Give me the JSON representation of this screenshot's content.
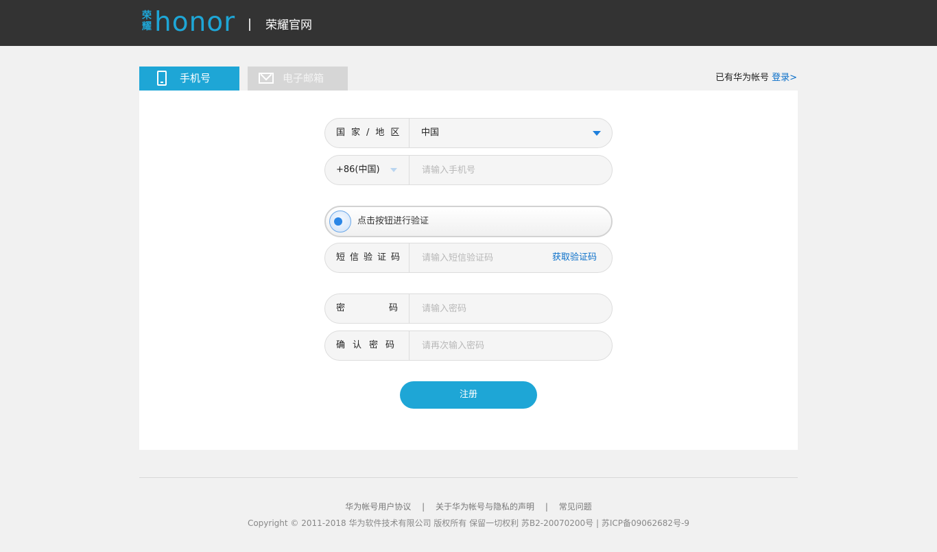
{
  "header": {
    "logo_cn": [
      "荣",
      "耀"
    ],
    "logo_word": "honor",
    "separator": "|",
    "site_title": "荣耀官网"
  },
  "tabs": [
    {
      "label": "手机号",
      "active": true,
      "icon": "phone-icon"
    },
    {
      "label": "电子邮箱",
      "active": false,
      "icon": "mail-icon"
    }
  ],
  "account_prompt": {
    "text": "已有华为帐号",
    "link": "登录>"
  },
  "form": {
    "country": {
      "label": "国家/地区",
      "value": "中国"
    },
    "phone": {
      "code": "+86(中国)",
      "placeholder": "请输入手机号"
    },
    "verify": {
      "text": "点击按钮进行验证"
    },
    "sms": {
      "label": "短信验证码",
      "placeholder": "请输入短信验证码",
      "get_code": "获取验证码"
    },
    "password": {
      "label_left": "密",
      "label_right": "码",
      "placeholder": "请输入密码"
    },
    "confirm": {
      "label": "确认密码",
      "placeholder": "请再次输入密码"
    },
    "submit": "注册"
  },
  "footer": {
    "links": [
      "华为帐号用户协议",
      "关于华为帐号与隐私的声明",
      "常见问题"
    ],
    "separator": "|",
    "copyright": "Copyright © 2011-2018  华为软件技术有限公司  版权所有  保留一切权利  苏B2-20070200号 | 苏ICP备09062682号-9"
  },
  "colors": {
    "accent": "#1ea6d6",
    "header_bg": "#333333",
    "link": "#0a6fc9",
    "page_bg": "#f1f1f1"
  }
}
